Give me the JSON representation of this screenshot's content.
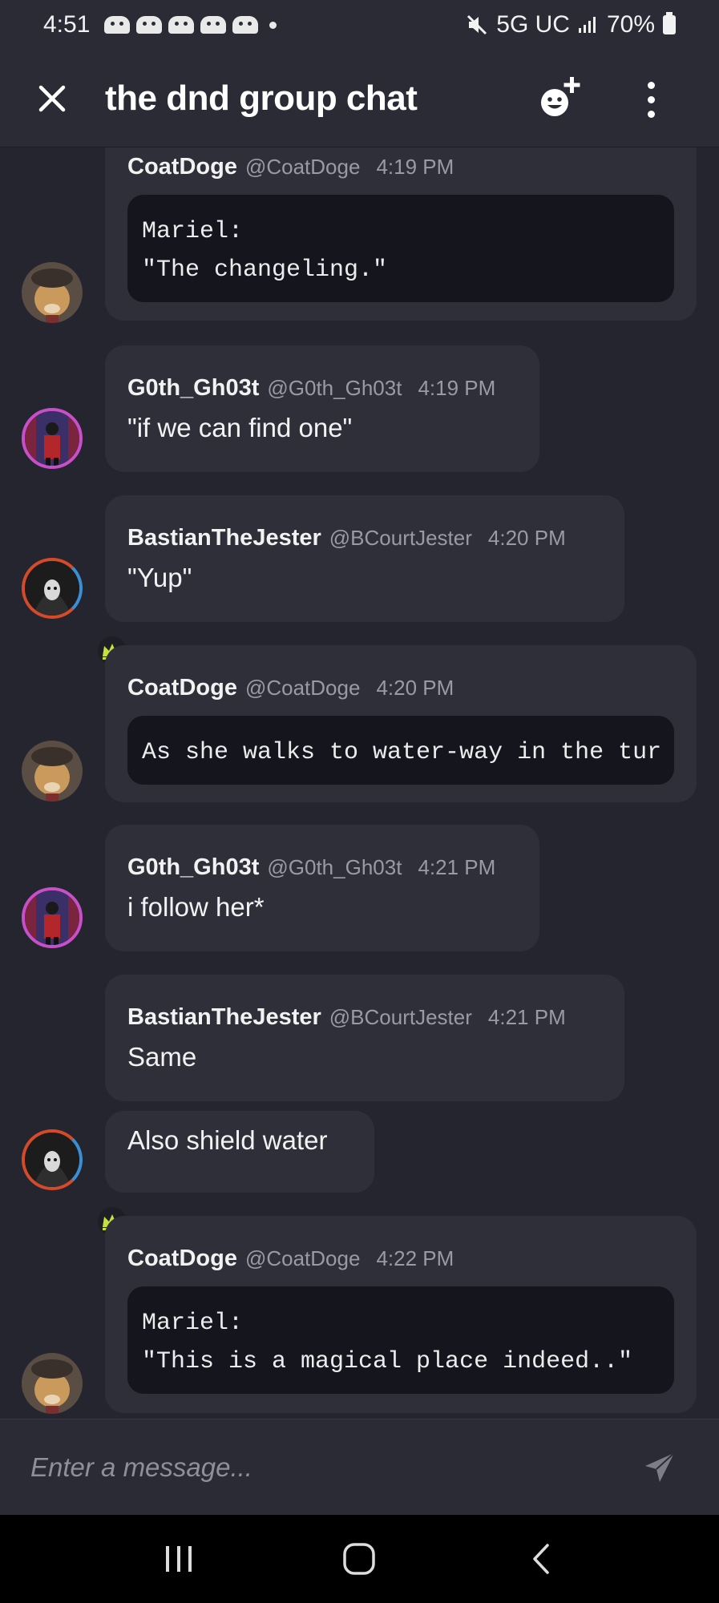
{
  "status_bar": {
    "time": "4:51",
    "network": "5G UC",
    "battery": "70%"
  },
  "header": {
    "title": "the dnd group chat",
    "close_icon": "close-icon",
    "add_reaction_icon": "add-emoji-icon",
    "more_icon": "more-vertical-icon"
  },
  "messages": [
    {
      "name": "CoatDoge",
      "handle": "@CoatDoge",
      "time": "4:19 PM",
      "code": "Mariel:\n\"The changeling.\""
    },
    {
      "name": "G0th_Gh03t",
      "handle": "@G0th_Gh03t",
      "time": "4:19 PM",
      "text": "\"if we can find one\""
    },
    {
      "name": "BastianTheJester",
      "handle": "@BCourtJester",
      "time": "4:20 PM",
      "text": "\"Yup\""
    },
    {
      "name": "CoatDoge",
      "handle": "@CoatDoge",
      "time": "4:20 PM",
      "code": "As she walks to water-way in the tur"
    },
    {
      "name": "G0th_Gh03t",
      "handle": "@G0th_Gh03t",
      "time": "4:21 PM",
      "text": "i follow her*"
    },
    {
      "name": "BastianTheJester",
      "handle": "@BCourtJester",
      "time": "4:21 PM",
      "text": "Same"
    },
    {
      "text": "Also shield water"
    },
    {
      "name": "CoatDoge",
      "handle": "@CoatDoge",
      "time": "4:22 PM",
      "code": "Mariel:\n\"This is a magical place indeed..\""
    }
  ],
  "composer": {
    "placeholder": "Enter a message..."
  },
  "colors": {
    "background": "#25252f",
    "bubble": "#2f2f39",
    "code_block": "#15151d",
    "crown": "#c6e13a"
  }
}
